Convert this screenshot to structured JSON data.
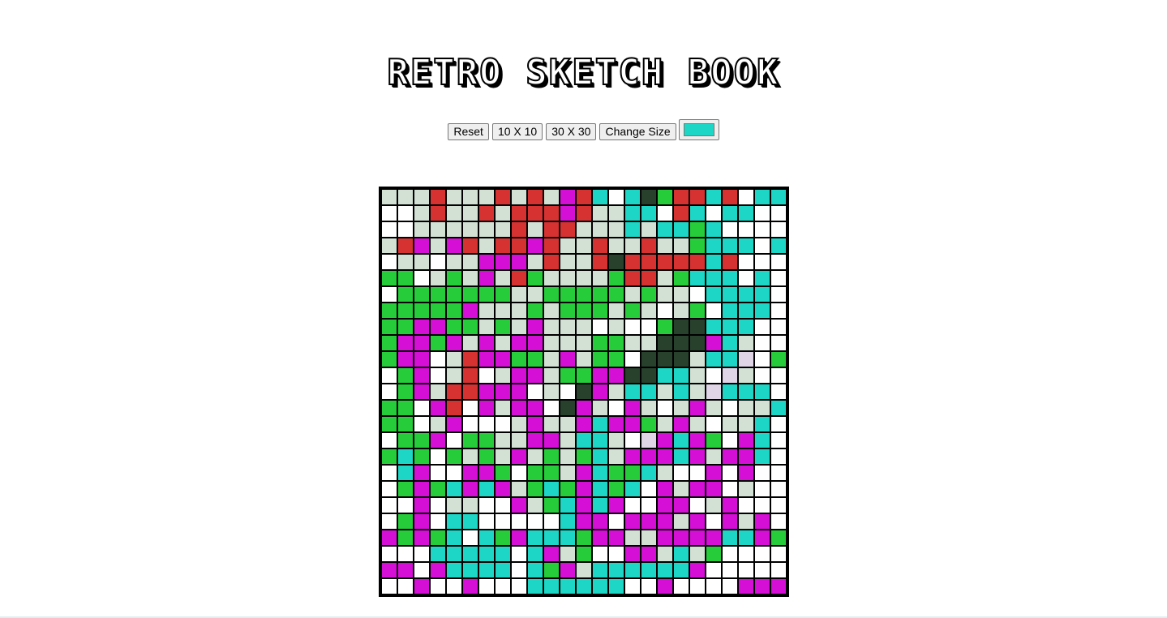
{
  "title": "RETRO SKETCH BOOK",
  "controls": {
    "reset_label": "Reset",
    "size10_label": "10 X 10",
    "size30_label": "30 X 30",
    "change_size_label": "Change Size",
    "current_color": "#1dd6c5"
  },
  "palette": {
    "W": "#ffffff",
    "L": "#d2e1d4",
    "R": "#d63232",
    "G": "#26cc3a",
    "M": "#d50fd5",
    "C": "#1dd6c5",
    "D": "#27412d",
    "P": "#e0d4e7"
  },
  "grid": {
    "size": 25,
    "rows": [
      "LLLRLLLRLRLMRCWCDGRRCRWCC",
      "WWLRLLRLRRRMRLLCCWRCWCCW",
      "WWLLLLLLRLRRLLLCLCCGCWW",
      "LRMLMRLRRMRLLRLLRLLGCCCWC",
      "WLLWLLMMMLRLLRDRRRRRCRWW",
      "GGWLGLMLRGLLLLGRRLGCCCWC",
      "WGGGGGGGLLGGGGGLGLLWCCCC",
      "GGGGGMLLLGLGGGLGLWLGWCCC",
      "GGMMGGLGLMLLLWLWWGDDCCC",
      "GMMGMLMLMMLLLGGLLDDDMCLW",
      "GMMWLRMMGGLMLGGWDDDLCCPWG",
      "WGMWLRWLMMLGGMMDDCCLWPLW",
      "WGMLRRMMMWLWDMLCCLCLPCCCW",
      "GGWMRWMLMMWDMLWMLWLMLWLLC",
      "GGWLMWWWLMLLMCMMGLMLWLLC",
      "WGGMWGGLLMMLCCLWPMCMGWMC",
      "GCGWGLGLMLGLGCLMMMCMLMMC",
      "WCMWWMMGWGGLMCGGCLWWMWMW",
      "WGMGCMCMLGCGMCGCWMLMMWL",
      "WWMWLLWWMLGCMCMWWMMWLMW",
      "WGMWCCWWWWWCMMWMMMLMWMLM",
      "MGMGCWCGMCCCGMMLLMMMMCCMG",
      "WWWCCCCCWCMLGWWMMLCLGWW",
      "MMWMCCCCWCGMLCCCCCCMWWW",
      "WWMWWMWWWCCCCCCWWMWWWWMMM"
    ]
  }
}
